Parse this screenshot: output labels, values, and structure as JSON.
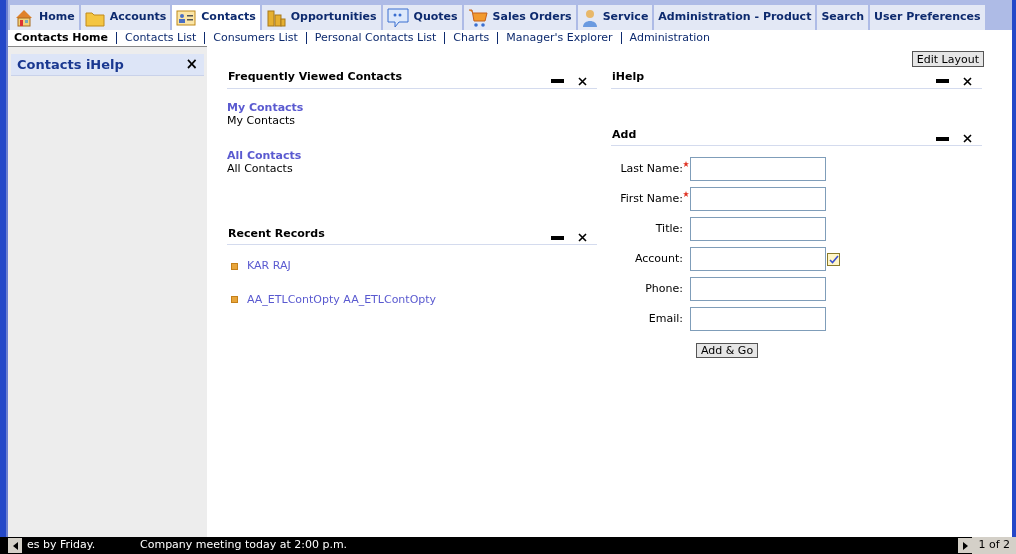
{
  "tabs": [
    {
      "label": "Home",
      "selected": false
    },
    {
      "label": "Accounts",
      "selected": false
    },
    {
      "label": "Contacts",
      "selected": true
    },
    {
      "label": "Opportunities",
      "selected": false
    },
    {
      "label": "Quotes",
      "selected": false
    },
    {
      "label": "Sales Orders",
      "selected": false
    },
    {
      "label": "Service",
      "selected": false
    },
    {
      "label": "Administration - Product",
      "selected": false
    },
    {
      "label": "Search",
      "selected": false
    },
    {
      "label": "User Preferences",
      "selected": false
    }
  ],
  "subnav": [
    {
      "label": "Contacts Home",
      "selected": true
    },
    {
      "label": "Contacts List",
      "selected": false
    },
    {
      "label": "Consumers List",
      "selected": false
    },
    {
      "label": "Personal Contacts List",
      "selected": false
    },
    {
      "label": "Charts",
      "selected": false
    },
    {
      "label": "Manager's Explorer",
      "selected": false
    },
    {
      "label": "Administration",
      "selected": false
    }
  ],
  "sidebar": {
    "title": "Contacts iHelp",
    "close": "×"
  },
  "edit_layout": "Edit Layout",
  "frequently_viewed": {
    "title": "Frequently Viewed Contacts",
    "items": [
      {
        "link": "My Contacts",
        "description": "My Contacts"
      },
      {
        "link": "All Contacts",
        "description": "All Contacts"
      }
    ]
  },
  "recent_records": {
    "title": "Recent Records",
    "items": [
      "KAR RAJ",
      "AA_ETLContOpty AA_ETLContOpty"
    ]
  },
  "ihelp": {
    "title": "iHelp"
  },
  "add": {
    "title": "Add",
    "fields": [
      {
        "label": "Last Name:",
        "required": true,
        "picker": false
      },
      {
        "label": "First Name:",
        "required": true,
        "picker": false
      },
      {
        "label": "Title:",
        "required": false,
        "picker": false
      },
      {
        "label": "Account:",
        "required": false,
        "picker": true
      },
      {
        "label": "Phone:",
        "required": false,
        "picker": false
      },
      {
        "label": "Email:",
        "required": false,
        "picker": false
      }
    ],
    "button": "Add & Go"
  },
  "ticker": {
    "messages": [
      "es by Friday.",
      "Company meeting today at 2:00 p.m."
    ],
    "page": "1 of 2"
  }
}
